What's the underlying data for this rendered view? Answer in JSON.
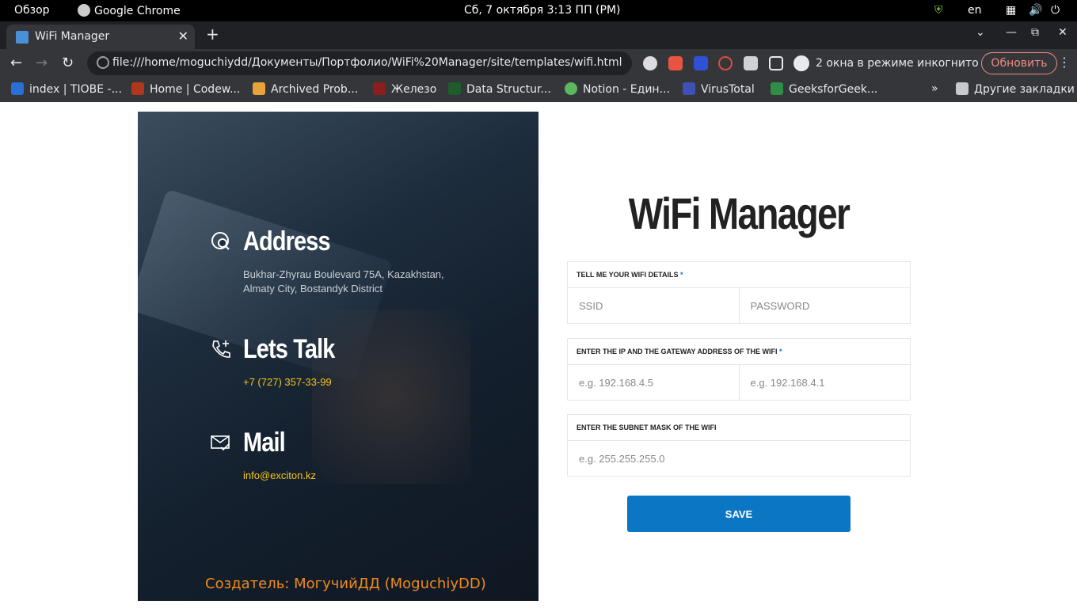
{
  "system_bar": {
    "activities": "Обзор",
    "app": "Google Chrome",
    "clock": "Сб, 7 октября   3:13 ПП (PM)",
    "lang": "en"
  },
  "browser": {
    "tab_title": "WiFi Manager",
    "url": "file:///home/moguchiydd/Документы/Портфолио/WiFi%20Manager/site/templates/wifi.html",
    "incognito": "2 окна в режиме инкогнито",
    "update_button": "Обновить",
    "bookmarks": [
      {
        "label": "index | TIOBE -...",
        "color": "#2a6fd6"
      },
      {
        "label": "Home | Codew...",
        "color": "#b1361e"
      },
      {
        "label": "Archived Prob...",
        "color": "#e8a43a"
      },
      {
        "label": "Железо",
        "color": "#8b1d1d"
      },
      {
        "label": "Data Structur...",
        "color": "#1f5c2c"
      },
      {
        "label": "Notion - Един...",
        "color": "#5cb85c"
      },
      {
        "label": "VirusTotal",
        "color": "#3f51b5"
      },
      {
        "label": "GeeksforGeek...",
        "color": "#2f8d46"
      }
    ],
    "other_bookmarks": "Другие закладки"
  },
  "contact": {
    "address_title": "Address",
    "address_text": "Bukhar-Zhyrau Boulevard 75A, Kazakhstan, Almaty City, Bostandyk District",
    "talk_title": "Lets Talk",
    "phone": "+7 (727) 357-33-99",
    "mail_title": "Mail",
    "email": "info@exciton.kz",
    "creator": "Создатель: МогучийДД (MoguchiyDD)"
  },
  "form": {
    "title": "WiFi Manager",
    "wifi_label": "TELL ME YOUR WIFI DETAILS",
    "ssid_placeholder": "SSID",
    "password_placeholder": "PASSWORD",
    "ip_label": "ENTER THE IP AND THE GATEWAY ADDRESS OF THE WIFI",
    "ip_placeholder": "e.g. 192.168.4.5",
    "gateway_placeholder": "e.g. 192.168.4.1",
    "subnet_label": "ENTER THE SUBNET MASK OF THE WIFI",
    "subnet_placeholder": "e.g. 255.255.255.0",
    "required_mark": "*",
    "save_button": "SAVE"
  }
}
